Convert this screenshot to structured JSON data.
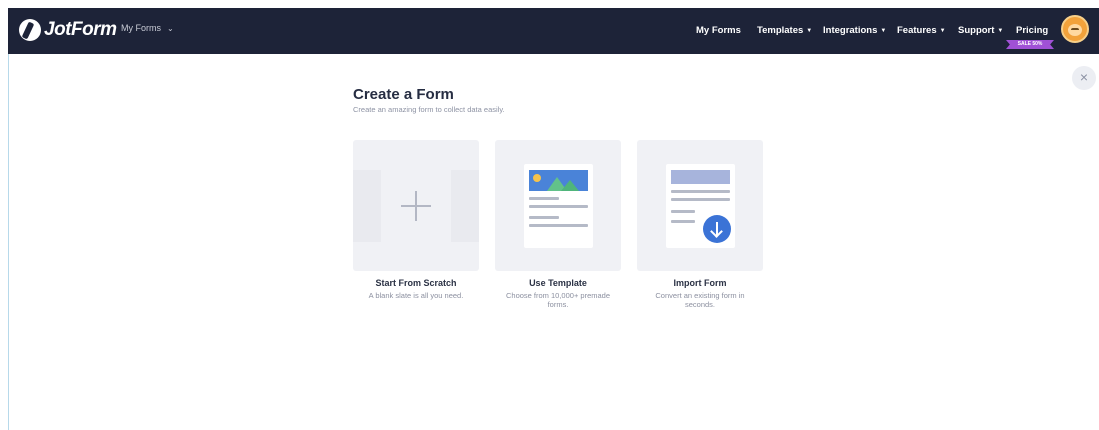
{
  "header": {
    "logo_text": "JotForm",
    "my_forms_dropdown": "My Forms",
    "nav": {
      "my_forms": "My Forms",
      "templates": "Templates",
      "integrations": "Integrations",
      "features": "Features",
      "support": "Support",
      "pricing": "Pricing"
    },
    "sale_badge": "SALE 50%",
    "bg_color": "#1d2338"
  },
  "close_label": "×",
  "page": {
    "title": "Create a Form",
    "subtitle": "Create an amazing form to collect data easily."
  },
  "options": [
    {
      "title": "Start From Scratch",
      "description": "A blank slate is all you need."
    },
    {
      "title": "Use Template",
      "description": "Choose from 10,000+ premade forms."
    },
    {
      "title": "Import Form",
      "description": "Convert an existing form in seconds."
    }
  ],
  "colors": {
    "accent_blue": "#3b73d6",
    "sale_purple": "#a051d6",
    "card_bg": "#f0f1f5"
  }
}
